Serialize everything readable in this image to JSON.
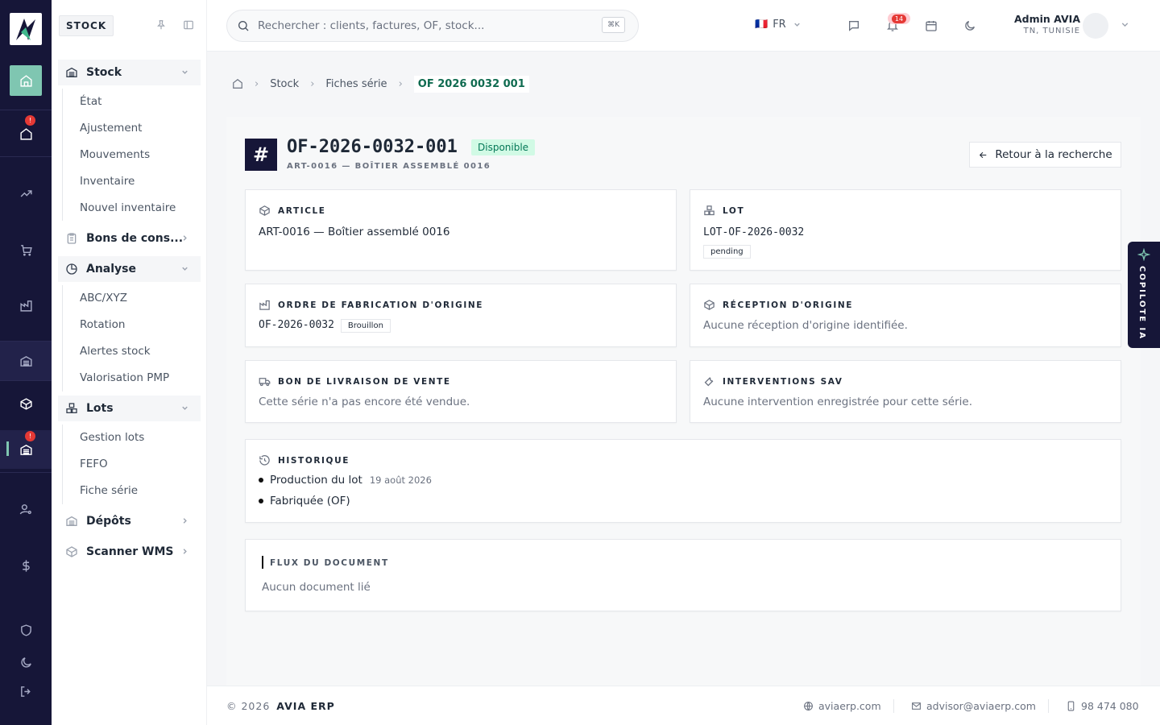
{
  "rail": {
    "home_badge": "!",
    "lots_badge": "!"
  },
  "sidebar": {
    "module": "STOCK",
    "groups": [
      {
        "label": "Stock",
        "items": [
          "État",
          "Ajustement",
          "Mouvements",
          "Inventaire",
          "Nouvel inventaire"
        ]
      },
      {
        "label": "Bons de cons..."
      },
      {
        "label": "Analyse",
        "items": [
          "ABC/XYZ",
          "Rotation",
          "Alertes stock",
          "Valorisation PMP"
        ]
      },
      {
        "label": "Lots",
        "items": [
          "Gestion lots",
          "FEFO",
          "Fiche série"
        ]
      },
      {
        "label": "Dépôts"
      },
      {
        "label": "Scanner WMS"
      }
    ]
  },
  "topbar": {
    "search_placeholder": "Rechercher : clients, factures, OF, stock...",
    "shortcut": "⌘K",
    "lang_flag": "🇫🇷",
    "lang": "FR",
    "notif_count": "14",
    "user_name": "Admin AVIA",
    "user_region": "TN, TUNISIE"
  },
  "breadcrumb": {
    "items": [
      "Stock",
      "Fiches série"
    ],
    "current": "OF 2026 0032 001"
  },
  "serial": {
    "title": "OF-2026-0032-001",
    "status": "Disponible",
    "subtitle": "ART-0016 — BOÎTIER ASSEMBLÉ 0016",
    "back_label": "Retour à la recherche"
  },
  "cards": {
    "article": {
      "label": "ARTICLE",
      "value": "ART-0016 — Boîtier assemblé 0016"
    },
    "lot": {
      "label": "LOT",
      "value": "LOT-OF-2026-0032",
      "tag": "pending"
    },
    "of": {
      "label": "ORDRE DE FABRICATION D'ORIGINE",
      "value": "OF-2026-0032",
      "tag": "Brouillon"
    },
    "reception": {
      "label": "RÉCEPTION D'ORIGINE",
      "value": "Aucune réception d'origine identifiée."
    },
    "bl": {
      "label": "BON DE LIVRAISON DE VENTE",
      "value": "Cette série n'a pas encore été vendue."
    },
    "sav": {
      "label": "INTERVENTIONS SAV",
      "value": "Aucune intervention enregistrée pour cette série."
    },
    "history": {
      "label": "HISTORIQUE",
      "items": [
        {
          "text": "Production du lot",
          "date": "19 août 2026"
        },
        {
          "text": "Fabriquée (OF)"
        }
      ]
    },
    "flux": {
      "label": "FLUX DU DOCUMENT",
      "value": "Aucun document lié"
    }
  },
  "copilot": {
    "label": "COPILOTE IA"
  },
  "footer": {
    "copyright": "© 2026",
    "brand": "AVIA ERP",
    "website": "aviaerp.com",
    "email": "advisor@aviaerp.com",
    "phone": "98 474 080"
  },
  "colors": {
    "navy": "#161638",
    "accent": "#7fc6b1",
    "status_green": "#047857",
    "alert": "#e53935"
  }
}
